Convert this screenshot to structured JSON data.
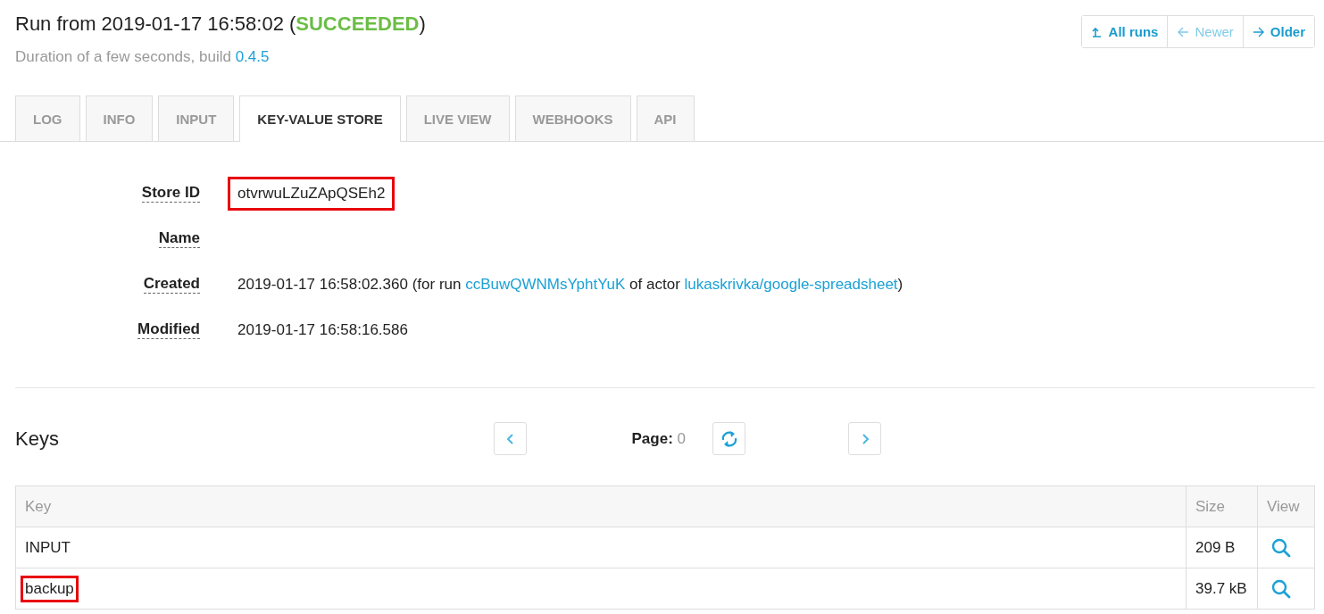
{
  "header": {
    "title": "Run from 2019-01-17 16:58:02 (",
    "status": "SUCCEEDED",
    "title_end": ")",
    "subtitle": "Duration of a few seconds, build ",
    "build": "0.4.5"
  },
  "nav_buttons": [
    {
      "label": "All runs",
      "kind": "up",
      "disabled": false
    },
    {
      "label": "Newer",
      "kind": "left",
      "disabled": true
    },
    {
      "label": "Older",
      "kind": "right",
      "disabled": false
    }
  ],
  "tabs": [
    {
      "label": "LOG",
      "selected": false
    },
    {
      "label": "INFO",
      "selected": false
    },
    {
      "label": "INPUT",
      "selected": false
    },
    {
      "label": "KEY-VALUE STORE",
      "selected": true
    },
    {
      "label": "LIVE VIEW",
      "selected": false
    },
    {
      "label": "WEBHOOKS",
      "selected": false
    },
    {
      "label": "API",
      "selected": false
    }
  ],
  "fields": [
    {
      "label": "Store ID",
      "highlighted": true,
      "parts": [
        {
          "kind": "text",
          "text": "otvrwuLZuZApQSEh2"
        }
      ]
    },
    {
      "label": "Name"
    },
    {
      "label": "Created",
      "highlighted": false,
      "parts": [
        {
          "kind": "text",
          "text": "2019-01-17 16:58:02.360 (for run "
        },
        {
          "kind": "link",
          "text": "ccBuwQWNMsYphtYuK"
        },
        {
          "kind": "text",
          "text": " of actor "
        },
        {
          "kind": "link",
          "text": "lukaskrivka/google-spreadsheet"
        },
        {
          "kind": "text",
          "text": ")"
        }
      ]
    },
    {
      "label": "Modified",
      "highlighted": false,
      "parts": [
        {
          "kind": "text",
          "text": "2019-01-17 16:58:16.586"
        }
      ]
    }
  ],
  "keys": {
    "title": "Keys",
    "page_label": "Page:",
    "page": "0"
  },
  "table": {
    "columns": [
      "Key",
      "Size",
      "View"
    ],
    "rows": [
      {
        "key": "INPUT",
        "size": "209 B",
        "highlighted": false
      },
      {
        "key": "backup",
        "size": "39.7 kB",
        "highlighted": true
      }
    ]
  }
}
